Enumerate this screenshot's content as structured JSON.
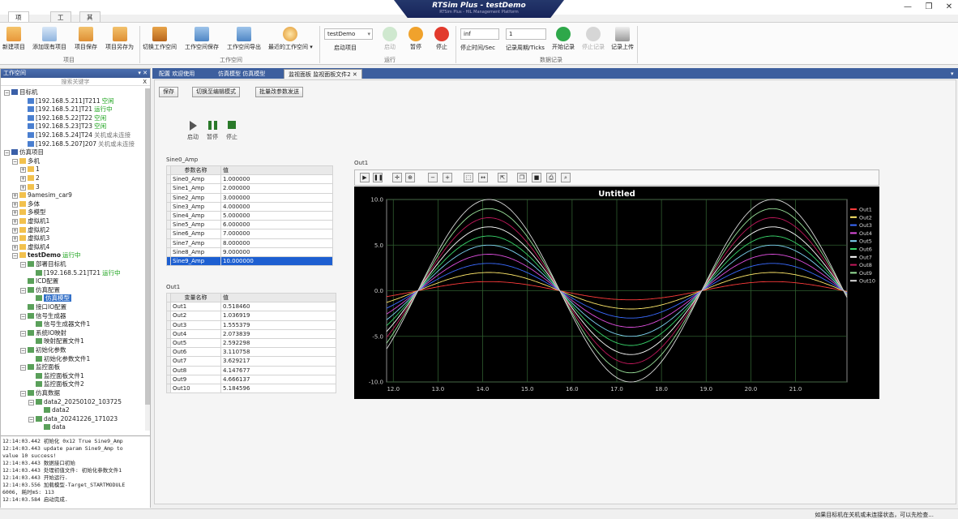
{
  "app": {
    "title": "RTSim Plus - testDemo",
    "subtitle": "RTSim Plus - HIL Management Platform"
  },
  "window_controls": [
    "—",
    "❐",
    "✕"
  ],
  "menu_tabs": [
    "项目和试验",
    "工具",
    "其他"
  ],
  "ribbon": {
    "buttons": [
      "新建项目",
      "添加现有项目",
      "项目保存",
      "项目另存为",
      "切换工作空间",
      "工作空间保存",
      "工作空间导出",
      "最近的工作空间 ▾",
      "启动项目",
      "启动",
      "暂停",
      "停止",
      "停止时间/Sec",
      "记录周期/Ticks",
      "开始记录",
      "停止记录",
      "记录上传"
    ],
    "groups": [
      "项目",
      "工作空间",
      "运行",
      "数据记录"
    ],
    "project_select": "testDemo",
    "stop_time": "inf",
    "record_period": "1"
  },
  "workspace": {
    "header": "工作空间",
    "pin": "▾ ✕",
    "search_placeholder": "搜索关键字",
    "search_clear": "X",
    "tree": [
      {
        "text": "目标机",
        "status": ""
      },
      {
        "text": "[192.168.5.211]T211",
        "status": "空闲"
      },
      {
        "text": "[192.168.5.21]T21",
        "status": "运行中"
      },
      {
        "text": "[192.168.5.22]T22",
        "status": "空闲"
      },
      {
        "text": "[192.168.5.23]T23",
        "status": "空闲"
      },
      {
        "text": "[192.168.5.24]T24",
        "status": "关机或未连接"
      },
      {
        "text": "[192.168.5.207]207",
        "status": "关机或未连接"
      },
      {
        "text": "仿真项目",
        "status": ""
      },
      {
        "text": "多机",
        "status": ""
      },
      {
        "text": "1",
        "status": ""
      },
      {
        "text": "2",
        "status": ""
      },
      {
        "text": "3",
        "status": ""
      },
      {
        "text": "9amesim_car9",
        "status": ""
      },
      {
        "text": "多体",
        "status": ""
      },
      {
        "text": "多模型",
        "status": ""
      },
      {
        "text": "虚拟机1",
        "status": ""
      },
      {
        "text": "虚拟机2",
        "status": ""
      },
      {
        "text": "虚拟机3",
        "status": ""
      },
      {
        "text": "虚拟机4",
        "status": ""
      },
      {
        "text": "testDemo",
        "status": "运行中"
      },
      {
        "text": "部署目标机",
        "status": ""
      },
      {
        "text": "[192.168.5.21]T21",
        "status": "运行中"
      },
      {
        "text": "ICD配置",
        "status": ""
      },
      {
        "text": "仿真配置",
        "status": ""
      },
      {
        "text": "仿真模型",
        "status": ""
      },
      {
        "text": "接口IO配置",
        "status": ""
      },
      {
        "text": "信号生成器",
        "status": ""
      },
      {
        "text": "信号生成器文件1",
        "status": ""
      },
      {
        "text": "系统IO映射",
        "status": ""
      },
      {
        "text": "映射配置文件1",
        "status": ""
      },
      {
        "text": "初始化参数",
        "status": ""
      },
      {
        "text": "初始化参数文件1",
        "status": ""
      },
      {
        "text": "监控面板",
        "status": ""
      },
      {
        "text": "监控面板文件1",
        "status": ""
      },
      {
        "text": "监控面板文件2",
        "status": ""
      },
      {
        "text": "仿真数据",
        "status": ""
      },
      {
        "text": "data2_20250102_103725",
        "status": ""
      },
      {
        "text": "data2",
        "status": ""
      },
      {
        "text": "data_20241226_171023",
        "status": ""
      },
      {
        "text": "data",
        "status": ""
      }
    ]
  },
  "log": [
    "12:14:03.442 初始化 0x12 True Sine9_Amp",
    "12:14:03.443 update param Sine9_Amp to",
    "value 10 success!",
    "12:14:03.443 数据接口初始",
    "12:14:03.443 处理初值文件: 初始化参数文件1",
    "12:14:03.443 开始运行.",
    "12:14:03.556 加载模型-Target_STARTMODULE",
    "6006, 耗时mS: 113",
    "12:14:03.584 启动完成."
  ],
  "doc_tabs": [
    "配置 欢迎使用",
    "仿真模型 仿真模型",
    "监视面板 监视面板文件2 ✕"
  ],
  "doc_tab_menu": "▾",
  "toolbar": {
    "save": "保存",
    "edit_mode": "切换至编辑模式",
    "batch_send": "批量改参数发送"
  },
  "run_controls": {
    "start": "启动",
    "pause": "暂停",
    "stop": "停止"
  },
  "param_table": {
    "title": "Sine0_Amp",
    "headers": [
      "参数名称",
      "值"
    ],
    "rows": [
      [
        "Sine0_Amp",
        "1.000000"
      ],
      [
        "Sine1_Amp",
        "2.000000"
      ],
      [
        "Sine2_Amp",
        "3.000000"
      ],
      [
        "Sine3_Amp",
        "4.000000"
      ],
      [
        "Sine4_Amp",
        "5.000000"
      ],
      [
        "Sine5_Amp",
        "6.000000"
      ],
      [
        "Sine6_Amp",
        "7.000000"
      ],
      [
        "Sine7_Amp",
        "8.000000"
      ],
      [
        "Sine8_Amp",
        "9.000000"
      ],
      [
        "Sine9_Amp",
        "10.000000"
      ]
    ]
  },
  "var_table": {
    "title": "Out1",
    "headers": [
      "变量名称",
      "值"
    ],
    "rows": [
      [
        "Out1",
        "0.518460"
      ],
      [
        "Out2",
        "1.036919"
      ],
      [
        "Out3",
        "1.555379"
      ],
      [
        "Out4",
        "2.073839"
      ],
      [
        "Out5",
        "2.592298"
      ],
      [
        "Out6",
        "3.110758"
      ],
      [
        "Out7",
        "3.629217"
      ],
      [
        "Out8",
        "4.147677"
      ],
      [
        "Out9",
        "4.666137"
      ],
      [
        "Out10",
        "5.184596"
      ]
    ]
  },
  "chart_panel_label": "Out1",
  "chart_data": {
    "type": "line",
    "title": "Untitled",
    "xlabel": "",
    "ylabel": "",
    "xlim": [
      11.85,
      22.15
    ],
    "ylim": [
      -10,
      10
    ],
    "xticks": [
      "12.0",
      "13.0",
      "14.0",
      "15.0",
      "16.0",
      "17.0",
      "18.0",
      "19.0",
      "20.0",
      "21.0"
    ],
    "yticks": [
      "10.0",
      "5.0",
      "0.0",
      "-5.0",
      "-10.0"
    ],
    "grid": true,
    "legend": "right",
    "background": "#000000",
    "series": [
      {
        "name": "Out1",
        "amplitude": 1,
        "color": "#ff3b3b"
      },
      {
        "name": "Out2",
        "amplitude": 2,
        "color": "#ffe86a"
      },
      {
        "name": "Out3",
        "amplitude": 3,
        "color": "#3a6bff"
      },
      {
        "name": "Out4",
        "amplitude": 4,
        "color": "#e04fe0"
      },
      {
        "name": "Out5",
        "amplitude": 5,
        "color": "#7fd4f4"
      },
      {
        "name": "Out6",
        "amplitude": 6,
        "color": "#39d66b"
      },
      {
        "name": "Out7",
        "amplitude": 7,
        "color": "#ffffff"
      },
      {
        "name": "Out8",
        "amplitude": 8,
        "color": "#c2185b"
      },
      {
        "name": "Out9",
        "amplitude": 9,
        "color": "#9be39b"
      },
      {
        "name": "Out10",
        "amplitude": 10,
        "color": "#d9d9d9"
      }
    ],
    "sine_period": 6.35,
    "zero_crossing": 12.55
  },
  "status_bar": "如果目标机在关机或未连接状态，可以先检查..."
}
